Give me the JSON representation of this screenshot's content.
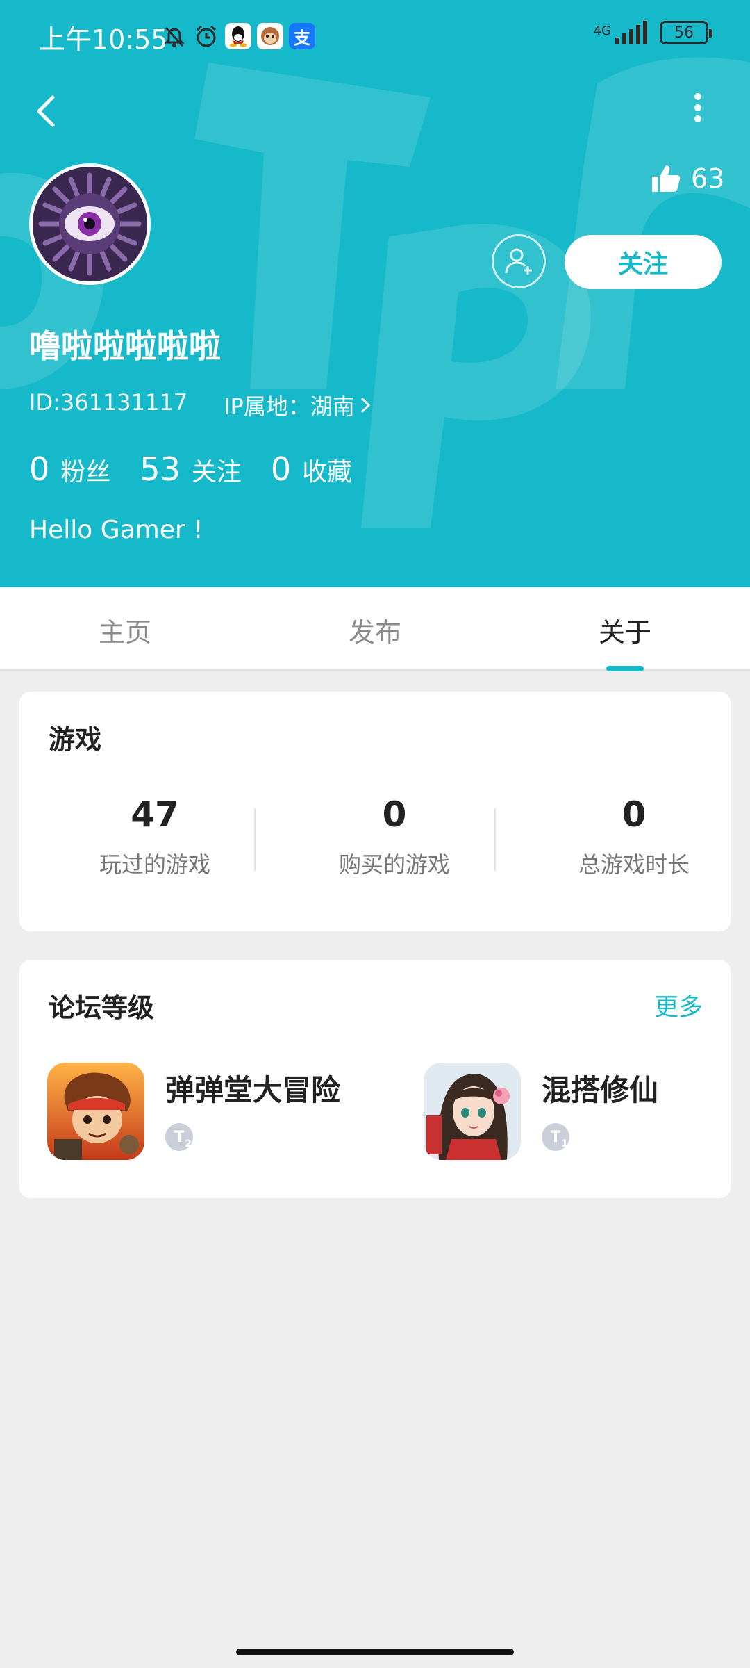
{
  "status_bar": {
    "time": "上午10:55",
    "network": "4G",
    "battery": "56",
    "icons": [
      "bell-off-icon",
      "alarm-icon",
      "qq-icon",
      "monkey-app-icon",
      "alipay-icon"
    ]
  },
  "header": {
    "background_color": "#15b9c9",
    "likes_count": "63",
    "follow_label": "关注",
    "username": "噜啦啦啦啦啦",
    "user_id": "ID:361131117",
    "ip_location": "IP属地：湖南",
    "stats": [
      {
        "num": "0",
        "label": "粉丝"
      },
      {
        "num": "53",
        "label": "关注"
      },
      {
        "num": "0",
        "label": "收藏"
      }
    ],
    "bio": "Hello Gamer !"
  },
  "tabs": [
    {
      "label": "主页"
    },
    {
      "label": "发布"
    },
    {
      "label": "关于"
    }
  ],
  "games_card": {
    "title": "游戏",
    "stats": [
      {
        "num": "47",
        "label": "玩过的游戏"
      },
      {
        "num": "0",
        "label": "购买的游戏"
      },
      {
        "num": "0",
        "label": "总游戏时长"
      }
    ]
  },
  "forum_card": {
    "title": "论坛等级",
    "more": "更多",
    "items": [
      {
        "name": "弹弹堂大冒险",
        "level": "2"
      },
      {
        "name": "混搭修仙",
        "level": "1"
      }
    ]
  },
  "accent_color": "#15b9c9"
}
